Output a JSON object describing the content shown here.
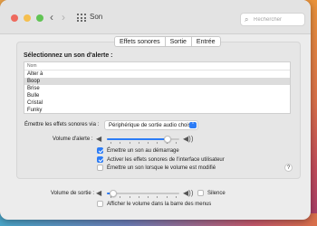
{
  "window": {
    "title": "Son",
    "back_glyph": "‹",
    "forward_glyph": "›",
    "search_icon": "⌕",
    "search_placeholder": "Rechercher"
  },
  "tabs": [
    "Effets sonores",
    "Sortie",
    "Entrée"
  ],
  "tab_selected": "Effets sonores",
  "alert": {
    "heading": "Sélectionnez un son d'alerte :",
    "list_header": "Nom",
    "items": [
      "Alter à",
      "Boop",
      "Brise",
      "Bulle",
      "Cristal",
      "Funky"
    ],
    "selected": "Boop"
  },
  "output_via": {
    "label": "Émettre les effets sonores via :",
    "value": "Périphérique de sortie audio choisi",
    "arrow": "⌃"
  },
  "alert_volume": {
    "label": "Volume d'alerte :",
    "level": 0.88,
    "icon_low": "◀",
    "icon_high": "◀))"
  },
  "checkboxes": [
    {
      "label": "Émettre un son au démarrage",
      "checked": true
    },
    {
      "label": "Activer les effets sonores de l'interface utilisateur",
      "checked": true
    },
    {
      "label": "Émettre un son lorsque le volume est modifié",
      "checked": false
    }
  ],
  "help_label": "?",
  "output_volume": {
    "label": "Volume de sortie :",
    "level": 0.04,
    "icon_low": "◀",
    "icon_high": "◀))",
    "mute_label": "Silence",
    "mute_checked": false
  },
  "menu_bar_checkbox": {
    "label": "Afficher le volume dans la barre des menus",
    "checked": false
  },
  "colors": {
    "accent": "#2c7cf6",
    "window_bg": "#ececec",
    "close": "#ee6a5e",
    "minimize": "#f5bf4f",
    "maximize": "#61c454"
  }
}
